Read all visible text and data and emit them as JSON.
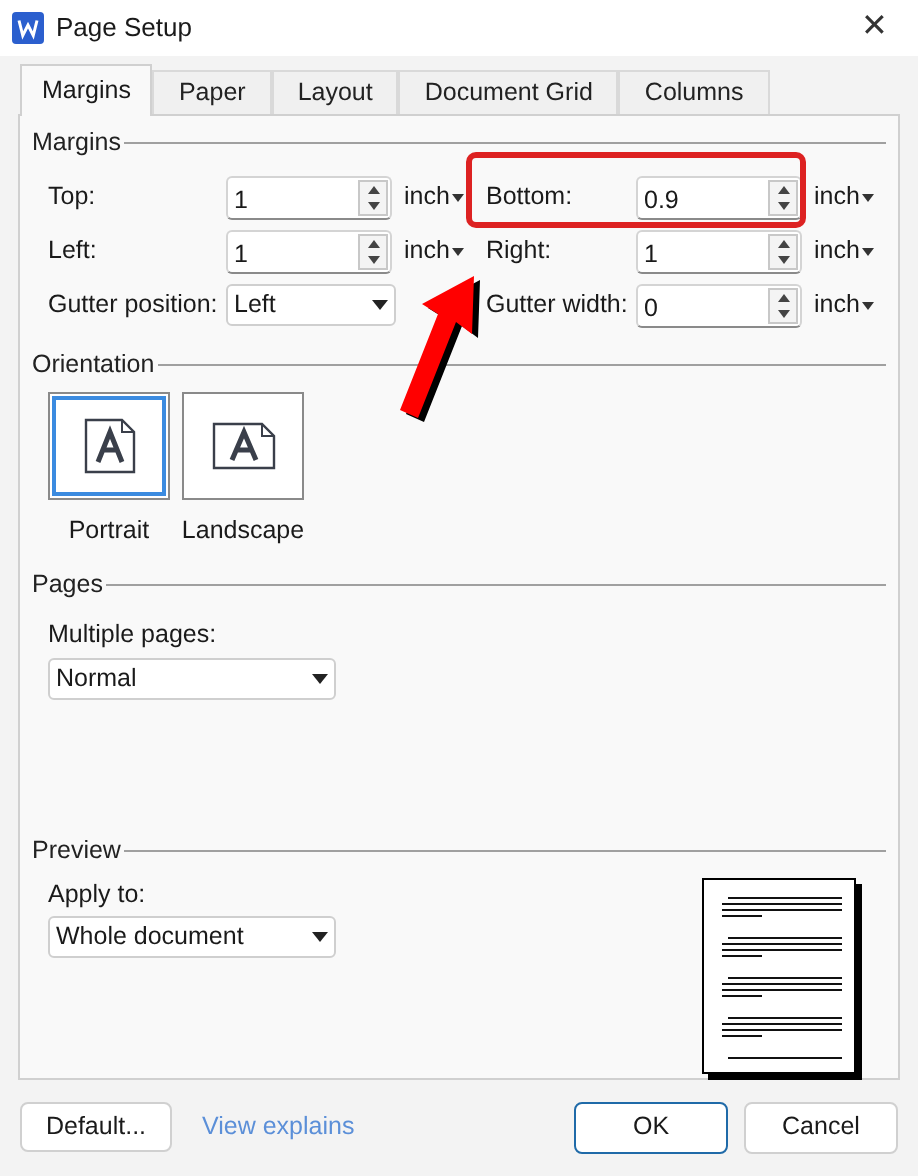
{
  "window": {
    "title": "Page Setup",
    "close": "✕"
  },
  "tabs": [
    {
      "label": "Margins",
      "selected": true
    },
    {
      "label": "Paper",
      "selected": false
    },
    {
      "label": "Layout",
      "selected": false
    },
    {
      "label": "Document Grid",
      "selected": false
    },
    {
      "label": "Columns",
      "selected": false
    }
  ],
  "margins": {
    "heading": "Margins",
    "rows": [
      [
        {
          "label": "Top:",
          "kind": "spin",
          "value": "1",
          "unit": "inch"
        },
        {
          "label": "Bottom:",
          "kind": "spin",
          "value": "0.9",
          "unit": "inch"
        }
      ],
      [
        {
          "label": "Left:",
          "kind": "spin",
          "value": "1",
          "unit": "inch"
        },
        {
          "label": "Right:",
          "kind": "spin",
          "value": "1",
          "unit": "inch"
        }
      ],
      [
        {
          "label": "Gutter position:",
          "kind": "select",
          "value": "Left"
        },
        {
          "label": "Gutter width:",
          "kind": "spin",
          "value": "0",
          "unit": "inch"
        }
      ]
    ]
  },
  "orientation": {
    "heading": "Orientation",
    "options": [
      {
        "label": "Portrait",
        "selected": true
      },
      {
        "label": "Landscape",
        "selected": false
      }
    ]
  },
  "pages": {
    "heading": "Pages",
    "label": "Multiple pages:",
    "value": "Normal"
  },
  "preview": {
    "heading": "Preview",
    "label": "Apply to:",
    "value": "Whole document"
  },
  "footer": {
    "default": "Default...",
    "link": "View explains",
    "ok": "OK",
    "cancel": "Cancel"
  }
}
